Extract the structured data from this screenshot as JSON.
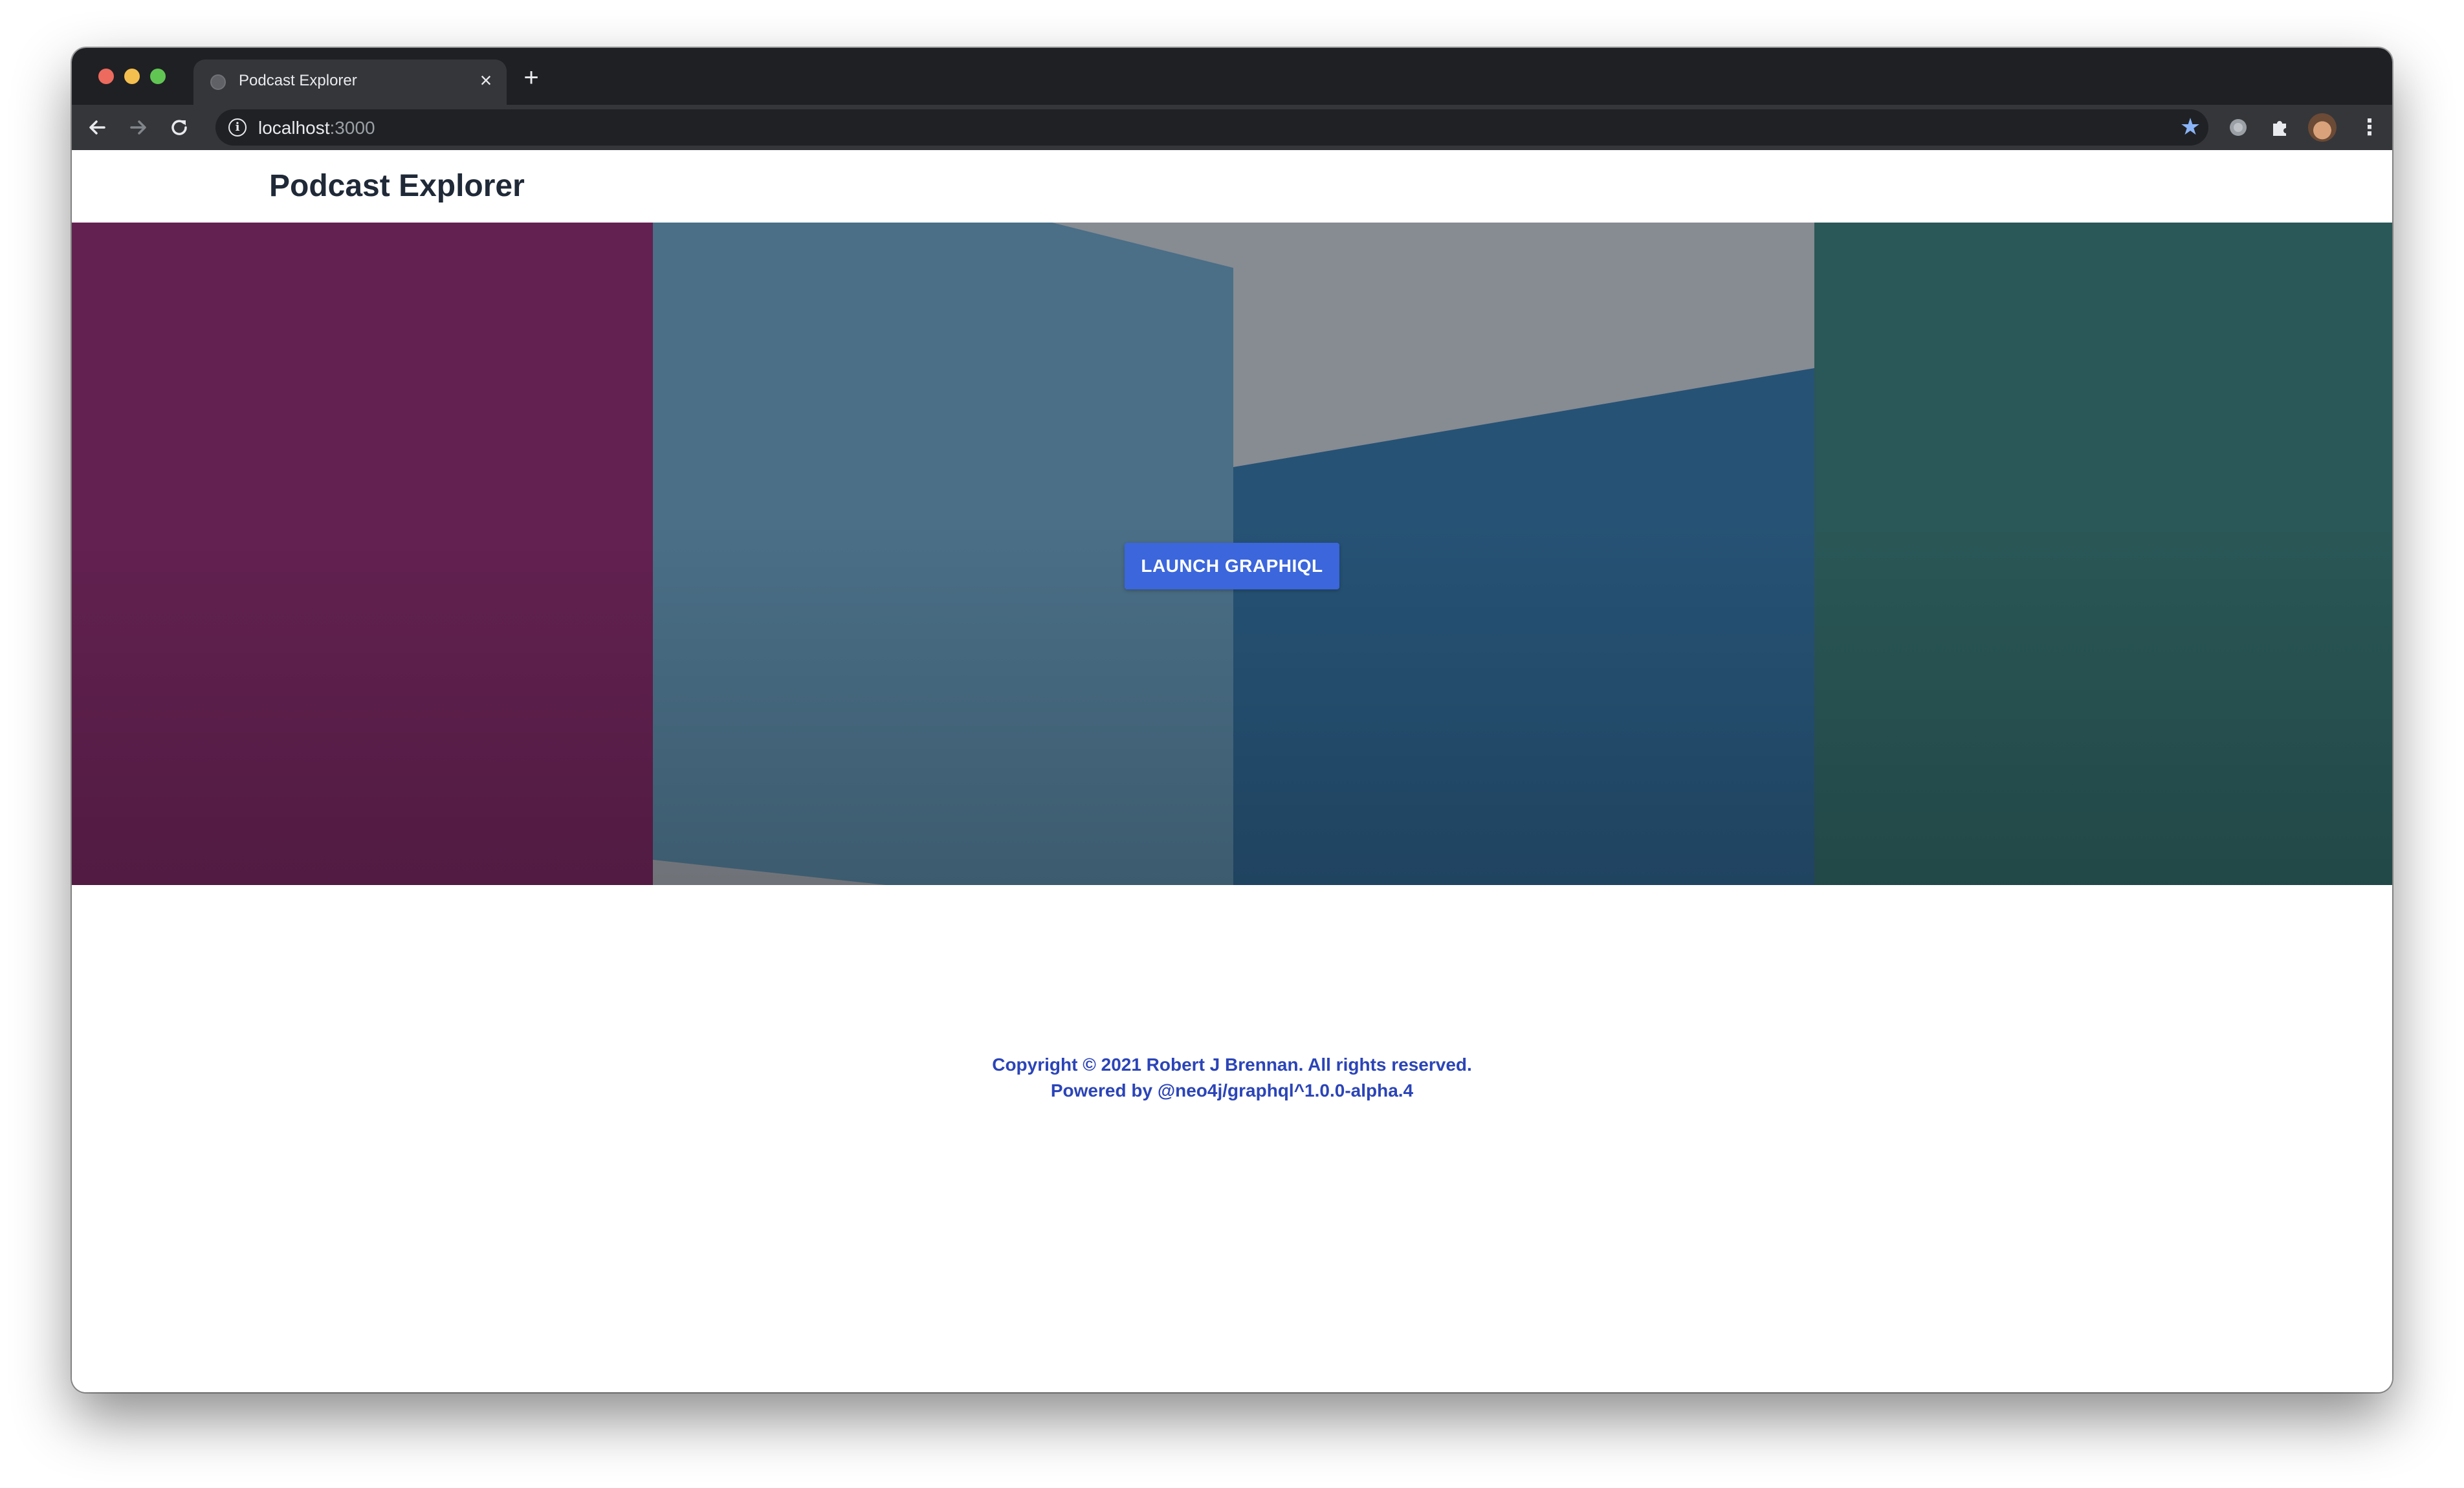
{
  "browser": {
    "tab": {
      "title": "Podcast Explorer",
      "close_glyph": "×",
      "favicon": "globe-icon"
    },
    "new_tab_glyph": "+",
    "address": {
      "host": "localhost",
      "port": ":3000"
    },
    "icons": [
      "back-arrow-icon",
      "forward-arrow-icon",
      "reload-icon",
      "info-icon",
      "star-icon",
      "extension-icon",
      "puzzle-icon",
      "avatar",
      "more-menu-icon"
    ],
    "info_glyph": "i",
    "star_glyph": "★",
    "menu_glyph": "⋮"
  },
  "app": {
    "title": "Podcast Explorer",
    "launch_button": "LAUNCH GRAPHIQL"
  },
  "hero": {
    "colors": {
      "purple": "#632151",
      "slate_blue": "#4a6f87",
      "gray": "#878b92",
      "steel_blue": "#265275",
      "teal": "#2a5757"
    }
  },
  "footer": {
    "copyright": "Copyright © 2021 Robert J Brennan. All rights reserved.",
    "powered_by": "Powered by @neo4j/graphql^1.0.0-alpha.4"
  },
  "colors": {
    "accent": "#3b66dc",
    "footer_text": "#2b44b8",
    "title_text": "#1f2937"
  }
}
